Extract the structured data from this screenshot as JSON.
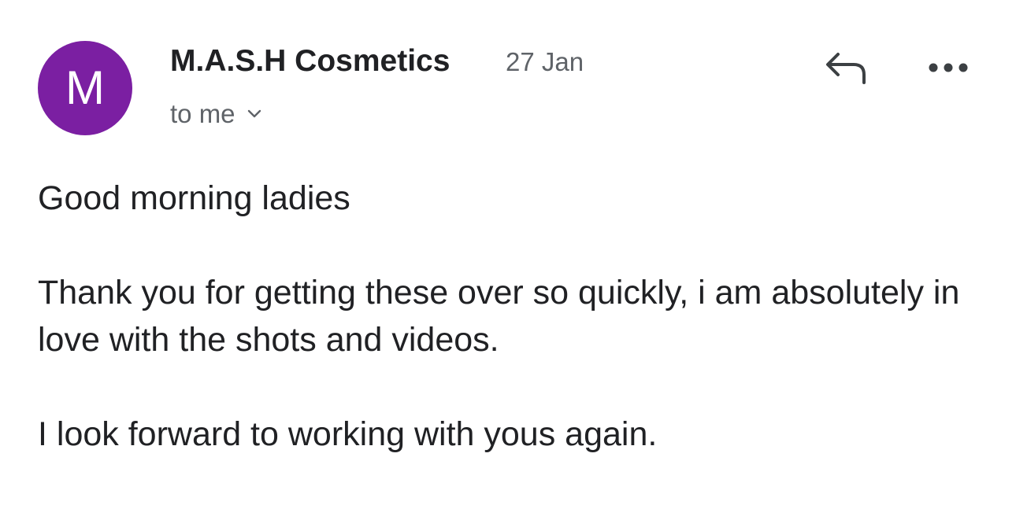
{
  "email": {
    "avatar_letter": "M",
    "avatar_color": "#7b1fa2",
    "sender": "M.A.S.H Cosmetics",
    "date": "27 Jan",
    "recipient": "to me",
    "icons": {
      "recipient_toggle": "chevron-down-icon",
      "reply": "reply-icon",
      "more": "more-options-icon"
    },
    "body": {
      "greeting": "Good morning ladies",
      "paragraph_1": "Thank you for getting these over so quickly, i am absolutely in love with the shots and videos.",
      "paragraph_2": "I look forward to working with yous again."
    }
  }
}
